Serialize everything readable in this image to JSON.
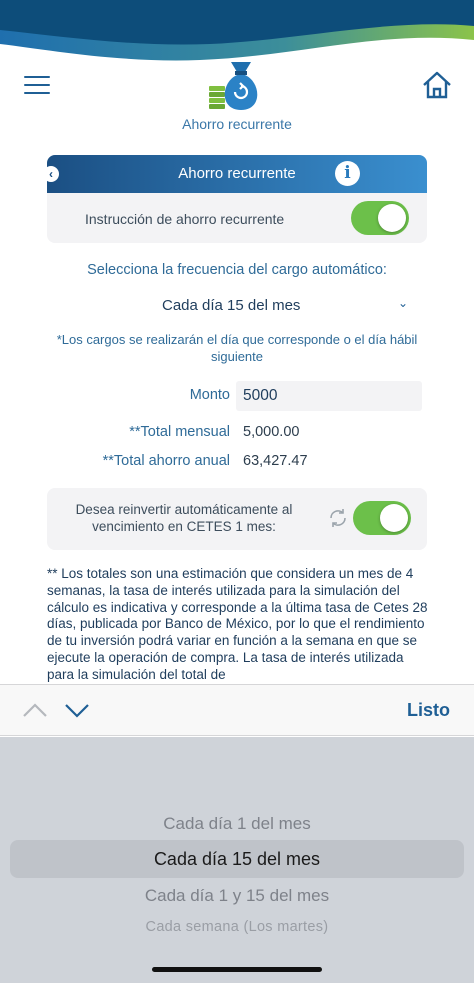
{
  "header": {
    "section_label": "Ahorro recurrente",
    "menu_icon": "hamburger-menu-icon",
    "home_icon": "home-icon",
    "logo_icon": "money-bag-icon"
  },
  "card": {
    "title": "Ahorro recurrente",
    "info_glyph": "i",
    "back_glyph": "‹",
    "instruction_label": "Instrucción de ahorro recurrente",
    "instruction_enabled": true
  },
  "frequency": {
    "label": "Selecciona la frecuencia del cargo automático:",
    "selected": "Cada día 15 del mes",
    "note": "*Los cargos se realizarán el día que corresponde o el día hábil siguiente"
  },
  "form": {
    "monto_label": "Monto",
    "monto_value": "5000",
    "total_mensual_label": "**Total mensual",
    "total_mensual_value": "5,000.00",
    "total_anual_label": "**Total ahorro anual",
    "total_anual_value": "63,427.47"
  },
  "reinvest": {
    "label": "Desea reinvertir automáticamente al vencimiento en CETES 1 mes:",
    "enabled": true
  },
  "disclaimer": "** Los totales son una estimación que considera un mes de 4 semanas, la tasa de interés utilizada para la simulación del cálculo es indicativa y corresponde a la última tasa de Cetes 28 días, publicada por Banco de México, por lo que el rendimiento de tu inversión podrá variar en función a la semana en que se ejecute la operación de compra. La tasa de interés utilizada para la simulación del total de",
  "accessory": {
    "done_label": "Listo"
  },
  "picker": {
    "options": [
      "Cada día 1 del mes",
      "Cada día 15 del mes",
      "Cada día 1 y 15 del mes",
      "Cada semana (Los martes)"
    ],
    "selected_index": 1
  },
  "colors": {
    "primary_blue": "#1f5f95",
    "toggle_green": "#6cc04a",
    "header_gradient_start": "#1b4f83",
    "header_gradient_end": "#3a8fcf",
    "wave_green": "#8bc34a",
    "wave_blue": "#0d4d7a"
  }
}
